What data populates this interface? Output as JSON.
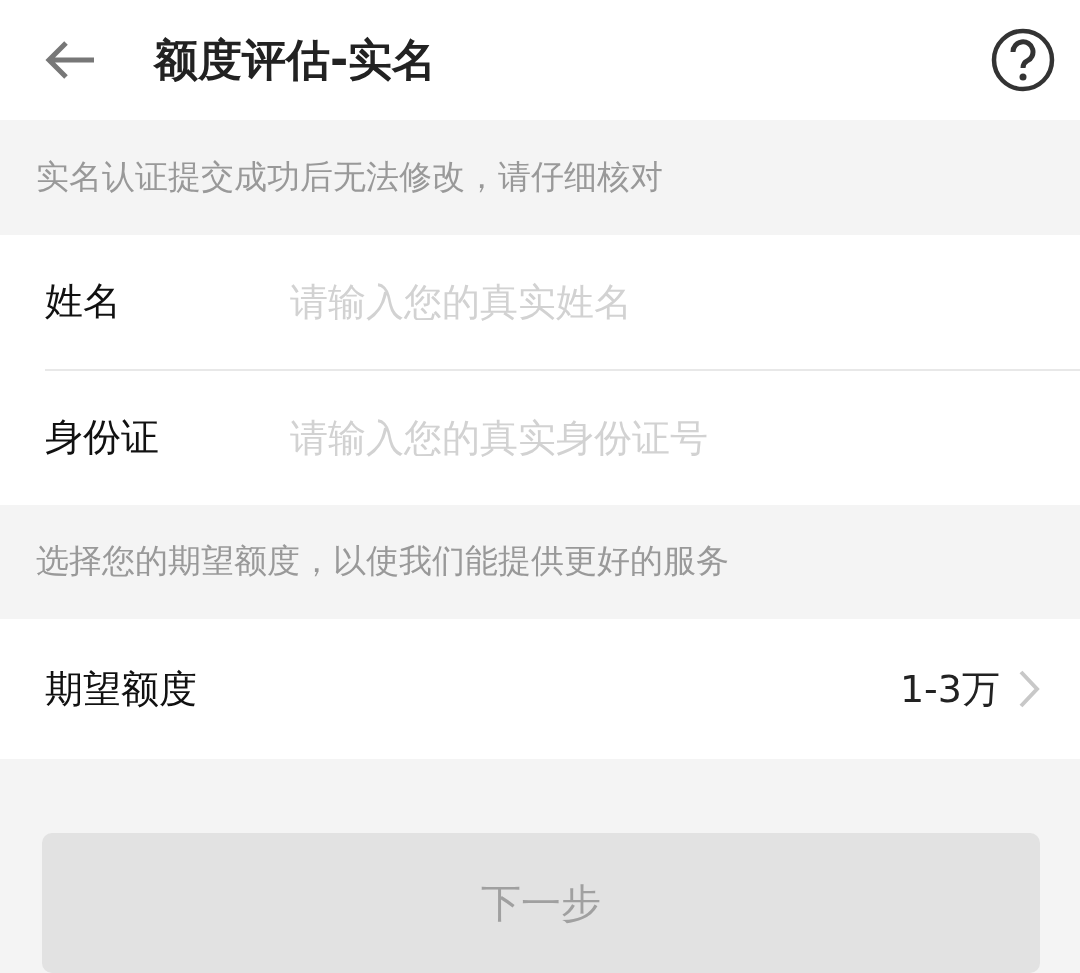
{
  "header": {
    "title": "额度评估-实名"
  },
  "notice": "实名认证提交成功后无法修改，请仔细核对",
  "fields": [
    {
      "label": "姓名",
      "placeholder": "请输入您的真实姓名"
    },
    {
      "label": "身份证",
      "placeholder": "请输入您的真实身份证号"
    }
  ],
  "amount_hint": "选择您的期望额度，以使我们能提供更好的服务",
  "amount": {
    "label": "期望额度",
    "value": "1-3万"
  },
  "next_button": {
    "label": "下一步",
    "disabled": true
  }
}
